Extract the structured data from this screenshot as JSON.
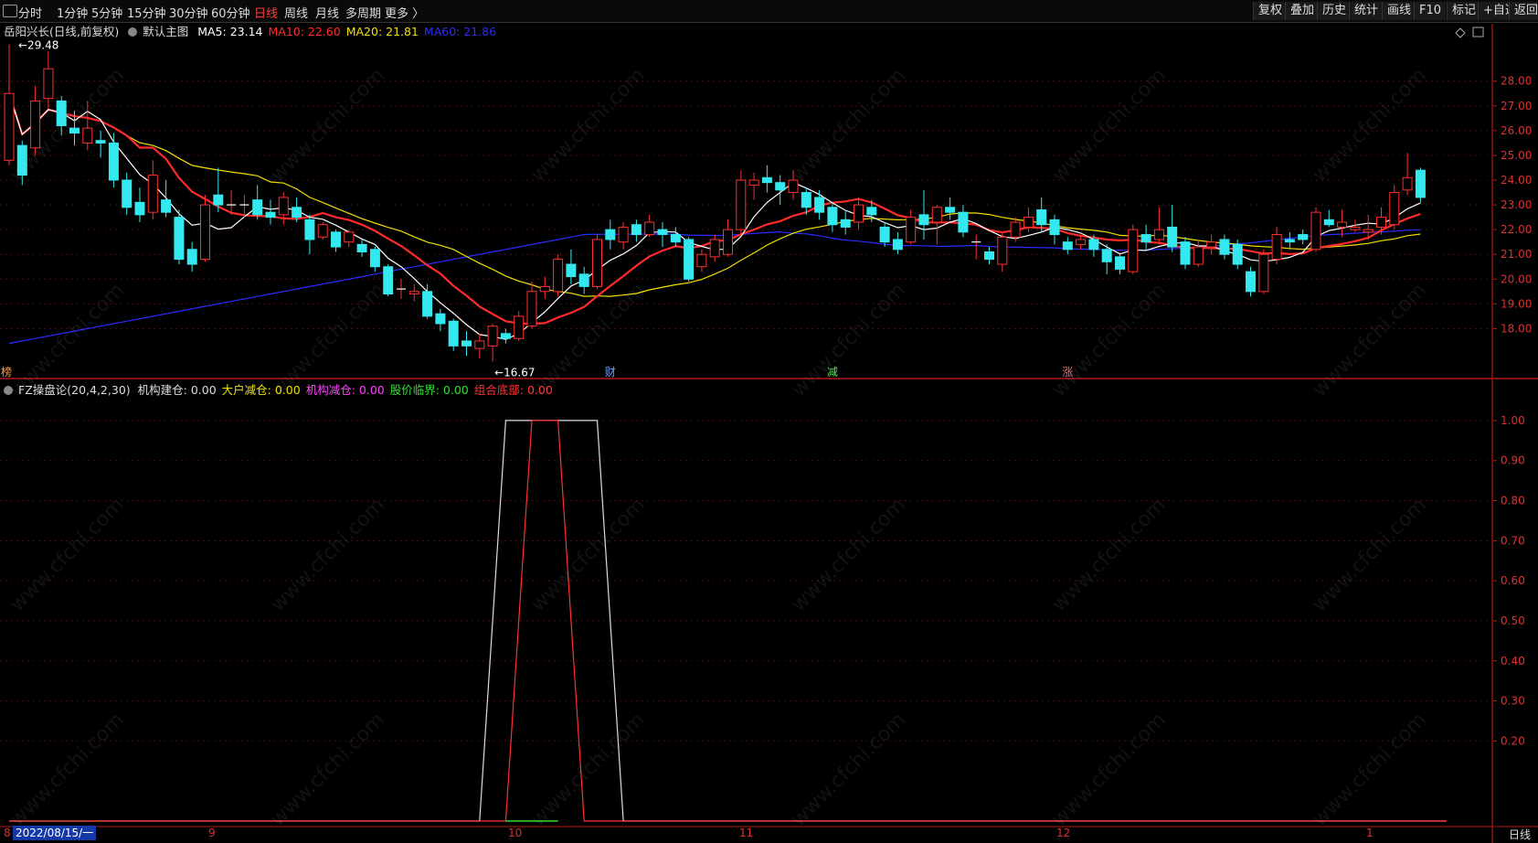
{
  "toolbar": {
    "periods": [
      {
        "label": "分时",
        "active": false
      },
      {
        "label": "1分钟",
        "active": false
      },
      {
        "label": "5分钟",
        "active": false
      },
      {
        "label": "15分钟",
        "active": false
      },
      {
        "label": "30分钟",
        "active": false
      },
      {
        "label": "60分钟",
        "active": false
      },
      {
        "label": "日线",
        "active": true
      },
      {
        "label": "周线",
        "active": false
      },
      {
        "label": "月线",
        "active": false
      },
      {
        "label": "多周期",
        "active": false
      },
      {
        "label": "更多 〉",
        "active": false
      }
    ],
    "right": [
      "复权",
      "叠加",
      "历史",
      "统计",
      "画线",
      "F10",
      "标记",
      "+自选",
      "返回"
    ]
  },
  "main_chart": {
    "stock": "岳阳兴长(日线,前复权)",
    "template": "默认主图",
    "ma": [
      {
        "label": "MA5: 23.14",
        "color": "#ffffff"
      },
      {
        "label": "MA10: 22.60",
        "color": "#ff2a2a"
      },
      {
        "label": "MA20: 21.81",
        "color": "#f0e000"
      },
      {
        "label": "MA60: 21.86",
        "color": "#2b2bff"
      }
    ],
    "high_label": "29.48",
    "low_label": "16.67",
    "y_ticks": [
      "28.00",
      "27.00",
      "26.00",
      "25.00",
      "24.00",
      "23.00",
      "22.00",
      "21.00",
      "20.00",
      "19.00",
      "18.00"
    ],
    "markers": [
      {
        "text": "榜",
        "color": "#ff9a3c"
      },
      {
        "text": "财",
        "color": "#6aa0ff"
      },
      {
        "text": "减",
        "color": "#66dd66"
      },
      {
        "text": "涨",
        "color": "#ff6060"
      }
    ]
  },
  "indicator": {
    "name": "FZ操盘论(20,4,2,30)",
    "values": [
      {
        "label": "机构建仓: 0.00",
        "color": "#dddddd"
      },
      {
        "label": "大户减仓: 0.00",
        "color": "#f0e000"
      },
      {
        "label": "机构减仓: 0.00",
        "color": "#ff40ff"
      },
      {
        "label": "股价临界: 0.00",
        "color": "#30e030"
      },
      {
        "label": "组合底部: 0.00",
        "color": "#ff3030"
      }
    ],
    "y_ticks": [
      "1.00",
      "0.90",
      "0.80",
      "0.70",
      "0.60",
      "0.50",
      "0.40",
      "0.30",
      "0.20"
    ]
  },
  "x_axis": {
    "cursor_date": "2022/08/15/一",
    "month_labels": [
      "8",
      "9",
      "10",
      "11",
      "12",
      "1"
    ],
    "period": "日线"
  },
  "chart_data": {
    "type": "candlestick",
    "title": "岳阳兴长(日线,前复权)",
    "y_range": [
      16.5,
      29.8
    ],
    "candles": [
      {
        "o": 24.8,
        "c": 27.5,
        "h": 29.48,
        "l": 24.6
      },
      {
        "o": 25.4,
        "c": 24.2,
        "h": 25.6,
        "l": 23.8
      },
      {
        "o": 25.3,
        "c": 27.2,
        "h": 27.8,
        "l": 25.0
      },
      {
        "o": 27.3,
        "c": 28.5,
        "h": 29.2,
        "l": 26.9
      },
      {
        "o": 27.2,
        "c": 26.2,
        "h": 27.4,
        "l": 25.8
      },
      {
        "o": 26.1,
        "c": 25.9,
        "h": 26.8,
        "l": 25.4
      },
      {
        "o": 25.5,
        "c": 26.1,
        "h": 27.2,
        "l": 25.2
      },
      {
        "o": 25.6,
        "c": 25.5,
        "h": 26.0,
        "l": 24.9
      },
      {
        "o": 25.5,
        "c": 24.0,
        "h": 25.9,
        "l": 23.7
      },
      {
        "o": 24.0,
        "c": 22.9,
        "h": 24.3,
        "l": 22.6
      },
      {
        "o": 23.1,
        "c": 22.6,
        "h": 23.7,
        "l": 22.3
      },
      {
        "o": 22.7,
        "c": 24.2,
        "h": 24.8,
        "l": 22.4
      },
      {
        "o": 23.2,
        "c": 22.7,
        "h": 24.0,
        "l": 22.5
      },
      {
        "o": 22.5,
        "c": 20.8,
        "h": 22.8,
        "l": 20.6
      },
      {
        "o": 21.2,
        "c": 20.6,
        "h": 21.5,
        "l": 20.3
      },
      {
        "o": 20.8,
        "c": 23.0,
        "h": 23.4,
        "l": 20.7
      },
      {
        "o": 23.4,
        "c": 23.0,
        "h": 24.5,
        "l": 22.7
      },
      {
        "o": 23.0,
        "c": 23.0,
        "h": 23.6,
        "l": 22.6
      },
      {
        "o": 23.0,
        "c": 23.0,
        "h": 23.4,
        "l": 22.5
      },
      {
        "o": 23.2,
        "c": 22.6,
        "h": 23.8,
        "l": 22.4
      },
      {
        "o": 22.7,
        "c": 22.5,
        "h": 23.2,
        "l": 22.2
      },
      {
        "o": 22.6,
        "c": 23.3,
        "h": 23.5,
        "l": 22.2
      },
      {
        "o": 22.9,
        "c": 22.5,
        "h": 23.3,
        "l": 22.3
      },
      {
        "o": 22.4,
        "c": 21.6,
        "h": 22.6,
        "l": 21.0
      },
      {
        "o": 21.7,
        "c": 22.2,
        "h": 22.3,
        "l": 21.6
      },
      {
        "o": 21.9,
        "c": 21.3,
        "h": 22.0,
        "l": 21.1
      },
      {
        "o": 21.5,
        "c": 21.9,
        "h": 22.0,
        "l": 21.3
      },
      {
        "o": 21.4,
        "c": 21.1,
        "h": 21.6,
        "l": 20.9
      },
      {
        "o": 21.2,
        "c": 20.5,
        "h": 21.3,
        "l": 20.3
      },
      {
        "o": 20.5,
        "c": 19.4,
        "h": 20.6,
        "l": 19.3
      },
      {
        "o": 19.6,
        "c": 19.6,
        "h": 20.0,
        "l": 19.2
      },
      {
        "o": 19.4,
        "c": 19.5,
        "h": 19.8,
        "l": 19.1
      },
      {
        "o": 19.5,
        "c": 18.5,
        "h": 19.8,
        "l": 18.4
      },
      {
        "o": 18.6,
        "c": 18.2,
        "h": 18.8,
        "l": 17.9
      },
      {
        "o": 18.3,
        "c": 17.3,
        "h": 18.4,
        "l": 17.1
      },
      {
        "o": 17.5,
        "c": 17.3,
        "h": 17.9,
        "l": 16.9
      },
      {
        "o": 17.2,
        "c": 17.5,
        "h": 17.8,
        "l": 16.8
      },
      {
        "o": 17.3,
        "c": 18.1,
        "h": 18.2,
        "l": 16.67
      },
      {
        "o": 17.8,
        "c": 17.6,
        "h": 18.0,
        "l": 17.4
      },
      {
        "o": 17.6,
        "c": 18.5,
        "h": 18.7,
        "l": 17.5
      },
      {
        "o": 18.1,
        "c": 19.5,
        "h": 19.9,
        "l": 18.0
      },
      {
        "o": 19.5,
        "c": 19.7,
        "h": 20.1,
        "l": 19.2
      },
      {
        "o": 19.5,
        "c": 20.8,
        "h": 21.0,
        "l": 19.3
      },
      {
        "o": 20.6,
        "c": 20.1,
        "h": 21.2,
        "l": 19.8
      },
      {
        "o": 20.2,
        "c": 19.7,
        "h": 20.5,
        "l": 19.4
      },
      {
        "o": 19.7,
        "c": 21.6,
        "h": 21.8,
        "l": 19.6
      },
      {
        "o": 22.0,
        "c": 21.6,
        "h": 22.4,
        "l": 21.2
      },
      {
        "o": 21.5,
        "c": 22.1,
        "h": 22.3,
        "l": 21.2
      },
      {
        "o": 22.2,
        "c": 21.8,
        "h": 22.4,
        "l": 21.5
      },
      {
        "o": 21.8,
        "c": 22.3,
        "h": 22.6,
        "l": 21.7
      },
      {
        "o": 22.0,
        "c": 21.8,
        "h": 22.3,
        "l": 21.3
      },
      {
        "o": 21.8,
        "c": 21.5,
        "h": 22.1,
        "l": 21.3
      },
      {
        "o": 21.6,
        "c": 20.0,
        "h": 21.7,
        "l": 19.9
      },
      {
        "o": 20.5,
        "c": 21.0,
        "h": 21.2,
        "l": 20.3
      },
      {
        "o": 20.9,
        "c": 21.6,
        "h": 21.8,
        "l": 20.7
      },
      {
        "o": 21.0,
        "c": 22.0,
        "h": 22.4,
        "l": 20.9
      },
      {
        "o": 22.0,
        "c": 24.0,
        "h": 24.4,
        "l": 21.8
      },
      {
        "o": 23.8,
        "c": 24.0,
        "h": 24.3,
        "l": 23.2
      },
      {
        "o": 24.1,
        "c": 23.9,
        "h": 24.6,
        "l": 23.5
      },
      {
        "o": 23.9,
        "c": 23.6,
        "h": 24.2,
        "l": 23.0
      },
      {
        "o": 23.5,
        "c": 24.0,
        "h": 24.4,
        "l": 23.2
      },
      {
        "o": 23.5,
        "c": 22.9,
        "h": 23.7,
        "l": 22.6
      },
      {
        "o": 23.3,
        "c": 22.7,
        "h": 23.6,
        "l": 22.4
      },
      {
        "o": 22.9,
        "c": 22.2,
        "h": 23.1,
        "l": 21.9
      },
      {
        "o": 22.4,
        "c": 22.1,
        "h": 22.8,
        "l": 21.8
      },
      {
        "o": 22.3,
        "c": 23.0,
        "h": 23.3,
        "l": 22.0
      },
      {
        "o": 22.9,
        "c": 22.6,
        "h": 23.2,
        "l": 22.3
      },
      {
        "o": 22.1,
        "c": 21.5,
        "h": 22.3,
        "l": 21.3
      },
      {
        "o": 21.6,
        "c": 21.2,
        "h": 21.9,
        "l": 21.0
      },
      {
        "o": 21.5,
        "c": 22.5,
        "h": 22.8,
        "l": 21.4
      },
      {
        "o": 22.6,
        "c": 22.2,
        "h": 23.6,
        "l": 21.6
      },
      {
        "o": 22.3,
        "c": 22.9,
        "h": 23.0,
        "l": 21.4
      },
      {
        "o": 22.9,
        "c": 22.7,
        "h": 23.3,
        "l": 22.4
      },
      {
        "o": 22.7,
        "c": 21.9,
        "h": 23.0,
        "l": 21.7
      },
      {
        "o": 21.5,
        "c": 21.5,
        "h": 21.8,
        "l": 20.8
      },
      {
        "o": 21.1,
        "c": 20.8,
        "h": 21.3,
        "l": 20.6
      },
      {
        "o": 20.6,
        "c": 21.7,
        "h": 21.9,
        "l": 20.3
      },
      {
        "o": 21.7,
        "c": 22.3,
        "h": 22.5,
        "l": 21.5
      },
      {
        "o": 22.1,
        "c": 22.5,
        "h": 22.9,
        "l": 21.9
      },
      {
        "o": 22.8,
        "c": 22.2,
        "h": 23.3,
        "l": 21.9
      },
      {
        "o": 22.4,
        "c": 21.8,
        "h": 22.6,
        "l": 21.4
      },
      {
        "o": 21.5,
        "c": 21.2,
        "h": 21.7,
        "l": 21.0
      },
      {
        "o": 21.4,
        "c": 21.6,
        "h": 21.8,
        "l": 21.2
      },
      {
        "o": 21.6,
        "c": 21.2,
        "h": 21.8,
        "l": 20.9
      },
      {
        "o": 21.2,
        "c": 20.7,
        "h": 21.4,
        "l": 20.2
      },
      {
        "o": 20.9,
        "c": 20.4,
        "h": 21.0,
        "l": 20.2
      },
      {
        "o": 20.3,
        "c": 22.0,
        "h": 22.2,
        "l": 20.2
      },
      {
        "o": 21.8,
        "c": 21.5,
        "h": 22.2,
        "l": 21.2
      },
      {
        "o": 21.6,
        "c": 22.0,
        "h": 22.9,
        "l": 21.4
      },
      {
        "o": 22.1,
        "c": 21.3,
        "h": 23.0,
        "l": 21.1
      },
      {
        "o": 21.5,
        "c": 20.6,
        "h": 21.7,
        "l": 20.4
      },
      {
        "o": 20.6,
        "c": 21.3,
        "h": 21.6,
        "l": 20.5
      },
      {
        "o": 21.3,
        "c": 21.5,
        "h": 21.8,
        "l": 21.0
      },
      {
        "o": 21.6,
        "c": 21.0,
        "h": 21.8,
        "l": 20.8
      },
      {
        "o": 21.4,
        "c": 20.6,
        "h": 21.6,
        "l": 20.4
      },
      {
        "o": 20.3,
        "c": 19.5,
        "h": 20.5,
        "l": 19.3
      },
      {
        "o": 19.5,
        "c": 21.0,
        "h": 21.2,
        "l": 19.4
      },
      {
        "o": 20.8,
        "c": 21.8,
        "h": 22.1,
        "l": 20.6
      },
      {
        "o": 21.6,
        "c": 21.5,
        "h": 21.9,
        "l": 21.2
      },
      {
        "o": 21.8,
        "c": 21.6,
        "h": 22.0,
        "l": 21.4
      },
      {
        "o": 21.2,
        "c": 22.7,
        "h": 22.9,
        "l": 21.1
      },
      {
        "o": 22.4,
        "c": 22.2,
        "h": 22.8,
        "l": 22.1
      },
      {
        "o": 22.1,
        "c": 22.3,
        "h": 22.8,
        "l": 21.7
      },
      {
        "o": 22.0,
        "c": 22.1,
        "h": 22.4,
        "l": 21.9
      },
      {
        "o": 21.9,
        "c": 22.0,
        "h": 22.6,
        "l": 21.6
      },
      {
        "o": 22.1,
        "c": 22.5,
        "h": 22.9,
        "l": 21.8
      },
      {
        "o": 22.2,
        "c": 23.5,
        "h": 23.8,
        "l": 22.0
      },
      {
        "o": 23.6,
        "c": 24.1,
        "h": 25.1,
        "l": 23.4
      },
      {
        "o": 24.4,
        "c": 23.3,
        "h": 24.5,
        "l": 23.1
      }
    ],
    "indicator_series": [
      {
        "name": "机构建仓",
        "color": "#dddddd",
        "values": [
          [
            0,
            0
          ],
          [
            36,
            0
          ],
          [
            38,
            1
          ],
          [
            45,
            1
          ],
          [
            47,
            0
          ],
          [
            110,
            0
          ]
        ]
      },
      {
        "name": "组合底部",
        "color": "#ff3030",
        "values": [
          [
            0,
            0
          ],
          [
            38,
            0
          ],
          [
            40,
            1
          ],
          [
            42,
            1
          ],
          [
            44,
            0
          ],
          [
            110,
            0
          ]
        ]
      },
      {
        "name": "股价临界",
        "color": "#30e030",
        "values": [
          [
            38,
            0
          ],
          [
            42,
            0
          ]
        ]
      }
    ],
    "indicator_y_range": [
      0,
      1.05
    ]
  }
}
